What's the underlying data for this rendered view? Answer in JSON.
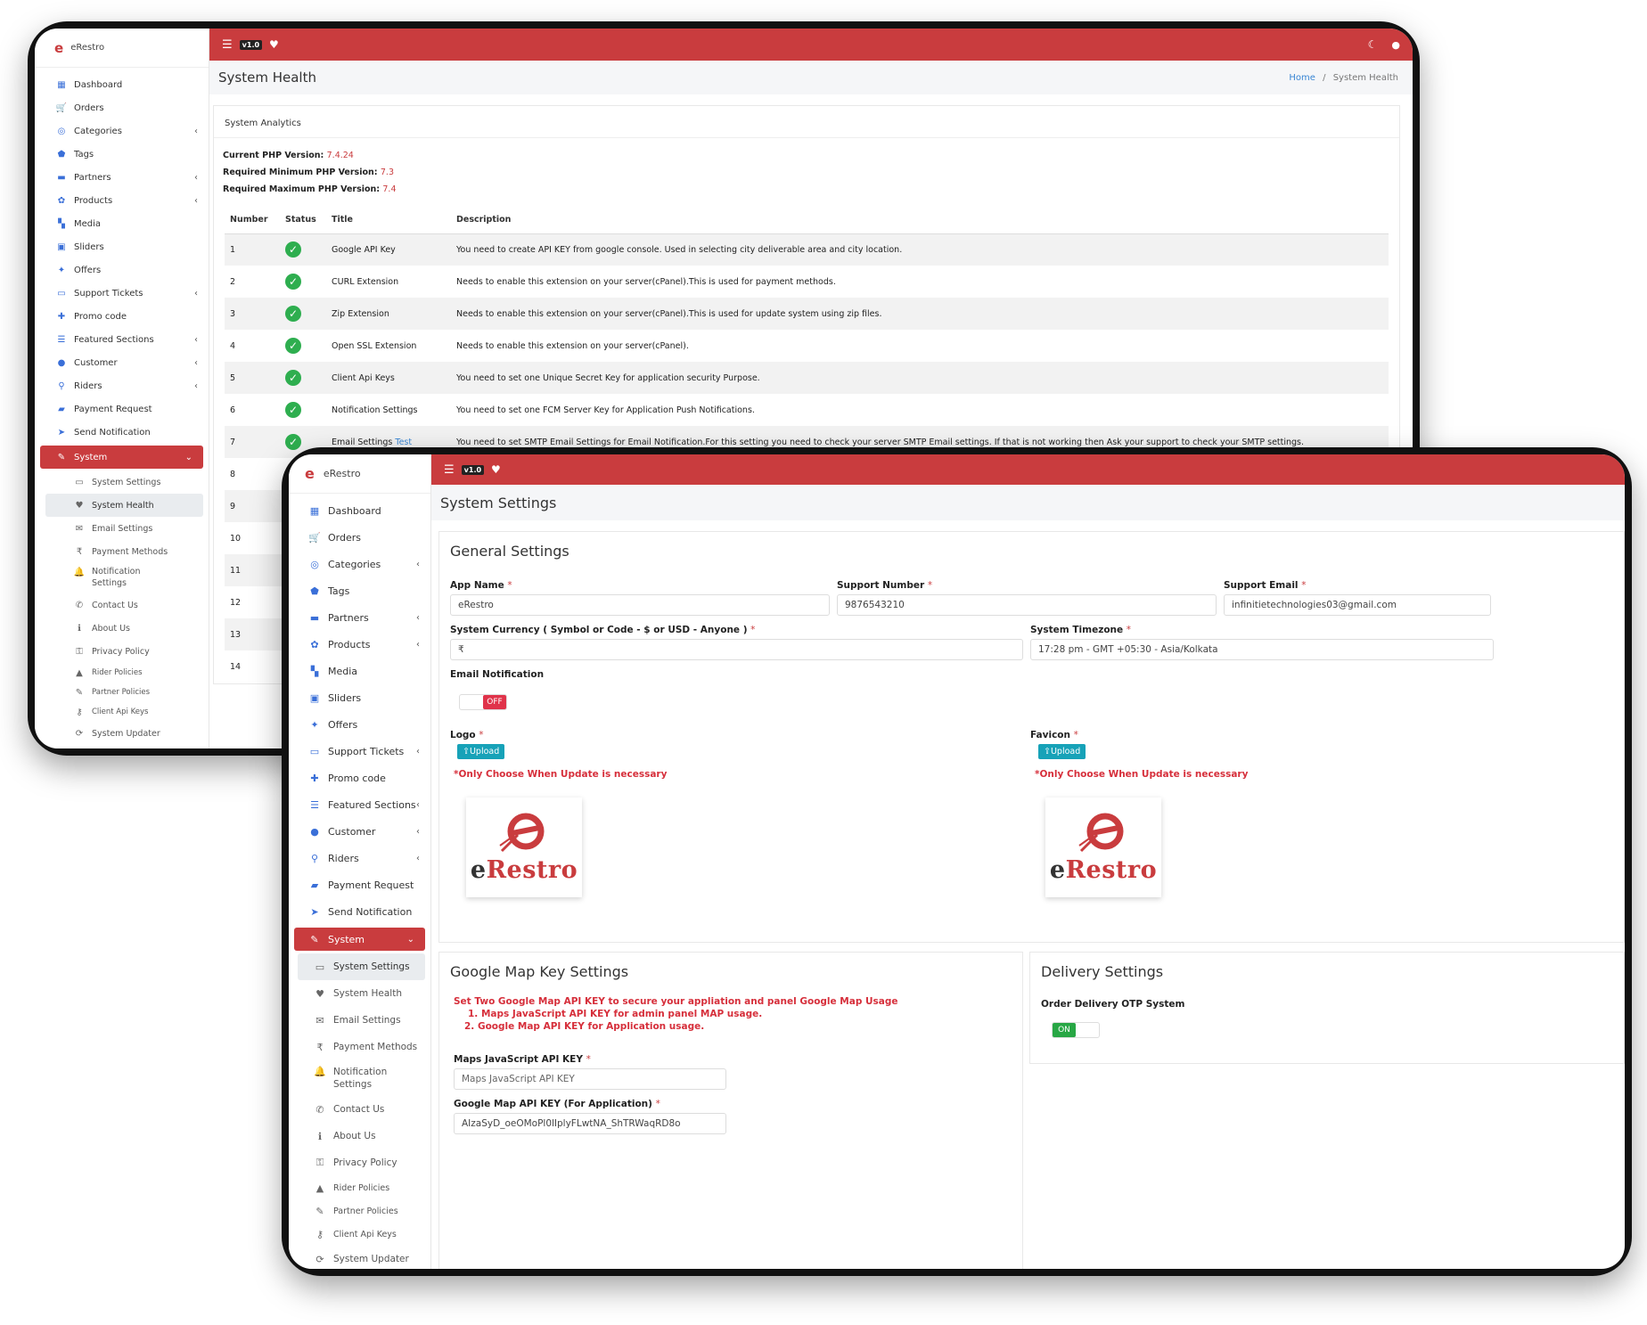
{
  "colors": {
    "brand": "#c93c3e",
    "ok": "#2eae4f",
    "warn": "#f4c20d",
    "link": "#3a86d4",
    "info": "#17a2b8"
  },
  "brand": {
    "name": "eRestro",
    "mark": "e"
  },
  "topbar": {
    "menu_icon": "menu-icon",
    "version": "v1.0",
    "heart_icon": "heart-icon",
    "moon_icon": "moon-icon",
    "user_icon": "user-icon"
  },
  "back": {
    "nav": [
      {
        "label": "Dashboard",
        "icon": "▦",
        "chev": false
      },
      {
        "label": "Orders",
        "icon": "🛒",
        "chev": false
      },
      {
        "label": "Categories",
        "icon": "◎",
        "chev": true
      },
      {
        "label": "Tags",
        "icon": "⬟",
        "chev": false
      },
      {
        "label": "Partners",
        "icon": "▬",
        "chev": true
      },
      {
        "label": "Products",
        "icon": "✿",
        "chev": true
      },
      {
        "label": "Media",
        "icon": "▚",
        "chev": false
      },
      {
        "label": "Sliders",
        "icon": "▣",
        "chev": false
      },
      {
        "label": "Offers",
        "icon": "✦",
        "chev": false
      },
      {
        "label": "Support Tickets",
        "icon": "▭",
        "chev": true
      },
      {
        "label": "Promo code",
        "icon": "✚",
        "chev": false
      },
      {
        "label": "Featured Sections",
        "icon": "☰",
        "chev": true
      },
      {
        "label": "Customer",
        "icon": "●",
        "chev": true
      },
      {
        "label": "Riders",
        "icon": "⚲",
        "chev": true
      },
      {
        "label": "Payment Request",
        "icon": "▰",
        "chev": false
      },
      {
        "label": "Send Notification",
        "icon": "➤",
        "chev": false
      }
    ],
    "system": "System",
    "sub": [
      {
        "label": "System Settings",
        "icon": "▭",
        "current": false,
        "size": ""
      },
      {
        "label": "System Health",
        "icon": "♥",
        "current": true,
        "size": ""
      },
      {
        "label": "Email Settings",
        "icon": "✉",
        "current": false,
        "size": ""
      },
      {
        "label": "Payment Methods",
        "icon": "₹",
        "current": false,
        "size": ""
      },
      {
        "label": "Notification Settings",
        "icon": "🔔",
        "current": false,
        "size": "tall"
      },
      {
        "label": "Contact Us",
        "icon": "✆",
        "current": false,
        "size": ""
      },
      {
        "label": "About Us",
        "icon": "ℹ",
        "current": false,
        "size": ""
      },
      {
        "label": "Privacy Policy",
        "icon": "⚿",
        "current": false,
        "size": ""
      },
      {
        "label": "Rider Policies",
        "icon": "▲",
        "current": false,
        "size": "small"
      },
      {
        "label": "Partner Policies",
        "icon": "✎",
        "current": false,
        "size": "small"
      },
      {
        "label": "Client Api Keys",
        "icon": "⚷",
        "current": false,
        "size": "small"
      },
      {
        "label": "System Updater",
        "icon": "⟳",
        "current": false,
        "size": ""
      }
    ],
    "page_title": "System Health",
    "breadcrumb": {
      "home": "Home",
      "sep": "/",
      "current": "System Health"
    },
    "analytics_title": "System Analytics",
    "versions": [
      {
        "label": "Current PHP Version:",
        "value": "7.4.24"
      },
      {
        "label": "Required Minimum PHP Version:",
        "value": "7.3"
      },
      {
        "label": "Required Maximum PHP Version:",
        "value": "7.4"
      }
    ],
    "table_headers": [
      "Number",
      "Status",
      "Title",
      "Description"
    ],
    "rows": [
      {
        "n": "1",
        "status": "ok",
        "title": "Google API Key",
        "link": "",
        "desc": "You need to create API KEY from google console. Used in selecting city deliverable area and city location."
      },
      {
        "n": "2",
        "status": "ok",
        "title": "CURL Extension",
        "link": "",
        "desc": "Needs to enable this extension on your server(cPanel).This is used for payment methods."
      },
      {
        "n": "3",
        "status": "ok",
        "title": "Zip Extension",
        "link": "",
        "desc": "Needs to enable this extension on your server(cPanel).This is used for update system using zip files."
      },
      {
        "n": "4",
        "status": "ok",
        "title": "Open SSL Extension",
        "link": "",
        "desc": "Needs to enable this extension on your server(cPanel)."
      },
      {
        "n": "5",
        "status": "ok",
        "title": "Client Api Keys",
        "link": "",
        "desc": "You need to set one Unique Secret Key for application security Purpose."
      },
      {
        "n": "6",
        "status": "ok",
        "title": "Notification Settings",
        "link": "",
        "desc": "You need to set one FCM Server Key for Application Push Notifications."
      },
      {
        "n": "7",
        "status": "ok",
        "title": "Email Settings",
        "link": "Test",
        "desc": "You need to set SMTP Email Settings for Email Notification.For this setting you need to check your server SMTP Email settings. If that is not working then Ask your support to check your SMTP settings."
      },
      {
        "n": "8",
        "status": "warn",
        "title": "",
        "link": "",
        "desc": ""
      },
      {
        "n": "9",
        "status": "ok",
        "title": "",
        "link": "",
        "desc": ""
      },
      {
        "n": "10",
        "status": "warn",
        "title": "",
        "link": "",
        "desc": ""
      },
      {
        "n": "11",
        "status": "ok",
        "title": "",
        "link": "",
        "desc": ""
      },
      {
        "n": "12",
        "status": "warn",
        "title": "",
        "link": "",
        "desc": ""
      },
      {
        "n": "13",
        "status": "warn",
        "title": "",
        "link": "",
        "desc": ""
      },
      {
        "n": "14",
        "status": "ok",
        "title": "",
        "link": "",
        "desc": ""
      }
    ]
  },
  "front": {
    "nav": [
      {
        "label": "Dashboard",
        "icon": "▦",
        "chev": false
      },
      {
        "label": "Orders",
        "icon": "🛒",
        "chev": false
      },
      {
        "label": "Categories",
        "icon": "◎",
        "chev": true
      },
      {
        "label": "Tags",
        "icon": "⬟",
        "chev": false
      },
      {
        "label": "Partners",
        "icon": "▬",
        "chev": true
      },
      {
        "label": "Products",
        "icon": "✿",
        "chev": true
      },
      {
        "label": "Media",
        "icon": "▚",
        "chev": false
      },
      {
        "label": "Sliders",
        "icon": "▣",
        "chev": false
      },
      {
        "label": "Offers",
        "icon": "✦",
        "chev": false
      },
      {
        "label": "Support Tickets",
        "icon": "▭",
        "chev": true
      },
      {
        "label": "Promo code",
        "icon": "✚",
        "chev": false
      },
      {
        "label": "Featured Sections",
        "icon": "☰",
        "chev": true
      },
      {
        "label": "Customer",
        "icon": "●",
        "chev": true
      },
      {
        "label": "Riders",
        "icon": "⚲",
        "chev": true
      },
      {
        "label": "Payment Request",
        "icon": "▰",
        "chev": false
      },
      {
        "label": "Send Notification",
        "icon": "➤",
        "chev": false
      }
    ],
    "system": "System",
    "sub": [
      {
        "label": "System Settings",
        "icon": "▭",
        "current": true,
        "size": ""
      },
      {
        "label": "System Health",
        "icon": "♥",
        "current": false,
        "size": ""
      },
      {
        "label": "Email Settings",
        "icon": "✉",
        "current": false,
        "size": ""
      },
      {
        "label": "Payment Methods",
        "icon": "₹",
        "current": false,
        "size": ""
      },
      {
        "label": "Notification Settings",
        "icon": "🔔",
        "current": false,
        "size": "tall"
      },
      {
        "label": "Contact Us",
        "icon": "✆",
        "current": false,
        "size": ""
      },
      {
        "label": "About Us",
        "icon": "ℹ",
        "current": false,
        "size": ""
      },
      {
        "label": "Privacy Policy",
        "icon": "⚿",
        "current": false,
        "size": ""
      },
      {
        "label": "Rider Policies",
        "icon": "▲",
        "current": false,
        "size": "small"
      },
      {
        "label": "Partner Policies",
        "icon": "✎",
        "current": false,
        "size": "small"
      },
      {
        "label": "Client Api Keys",
        "icon": "⚷",
        "current": false,
        "size": "small"
      },
      {
        "label": "System Updater",
        "icon": "⟳",
        "current": false,
        "size": ""
      }
    ],
    "page_title": "System Settings",
    "general": {
      "title": "General Settings",
      "app_name_label": "App Name",
      "app_name_value": "eRestro",
      "support_number_label": "Support Number",
      "support_number_value": "9876543210",
      "support_email_label": "Support Email",
      "support_email_value": "infinitietechnologies03@gmail.com",
      "currency_label": "System Currency ( Symbol or Code - $ or USD - Anyone )",
      "currency_value": "₹",
      "timezone_label": "System Timezone",
      "timezone_value": "17:28 pm - GMT +05:30 - Asia/Kolkata",
      "email_notification_label": "Email Notification",
      "email_notification_state": "OFF",
      "logo_label": "Logo",
      "favicon_label": "Favicon",
      "upload_label": "Upload",
      "upload_note": "*Only Choose When Update is necessary",
      "required": "*"
    },
    "map": {
      "title": "Google Map Key Settings",
      "note_lines": [
        "Set Two Google Map API KEY to secure your appliation and panel Google Map Usage",
        "1. Maps JavaScript API KEY for admin panel MAP usage.",
        "2. Google Map API KEY for Application usage."
      ],
      "js_key_label": "Maps JavaScript API KEY",
      "js_key_placeholder": "Maps JavaScript API KEY",
      "app_key_label": "Google Map API KEY (For Application)",
      "app_key_value": "AIzaSyD_oeOMoPl0lIplyFLwtNA_ShTRWaqRD8o"
    },
    "delivery": {
      "title": "Delivery Settings",
      "otp_label": "Order Delivery OTP System",
      "otp_state": "ON"
    }
  }
}
